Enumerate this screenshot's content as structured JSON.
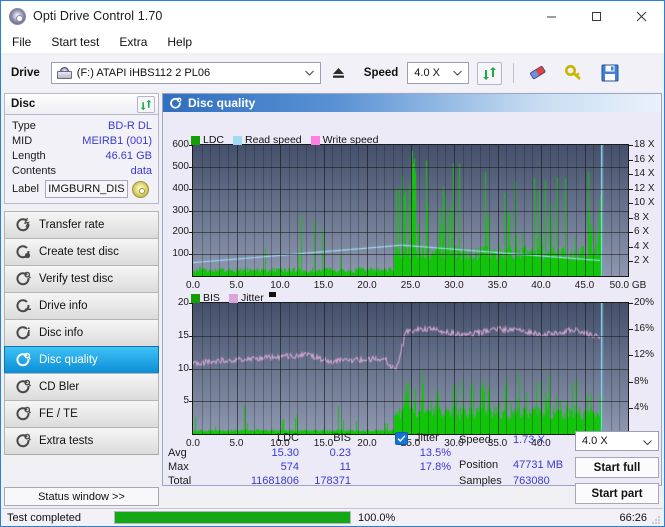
{
  "window": {
    "title": "Opti Drive Control 1.70",
    "icon": "disc-icon",
    "minimize": "minimize",
    "maximize": "maximize",
    "close": "close"
  },
  "menu": {
    "items": [
      {
        "label": "File"
      },
      {
        "label": "Start test"
      },
      {
        "label": "Extra"
      },
      {
        "label": "Help"
      }
    ]
  },
  "toolbar": {
    "drive_label": "Drive",
    "drive_value": "(F:)  ATAPI iHBS112  2 PL06",
    "eject_icon": "eject-icon",
    "speed_label": "Speed",
    "speed_value": "4.0 X",
    "refresh_icon": "refresh-icon",
    "eraser_icon": "eraser-icon",
    "key_icon": "key-icon",
    "save_icon": "save-icon"
  },
  "disc_panel": {
    "header": "Disc",
    "refresh_icon": "refresh-icon",
    "rows": [
      {
        "key": "Type",
        "value": "BD-R DL"
      },
      {
        "key": "MID",
        "value": "MEIRB1 (001)"
      },
      {
        "key": "Length",
        "value": "46.61 GB"
      },
      {
        "key": "Contents",
        "value": "data"
      }
    ],
    "label_key": "Label",
    "label_value": "IMGBURN_DIS",
    "label_icon": "disc-icon"
  },
  "nav": {
    "items": [
      {
        "label": "Transfer rate",
        "icon": "transfer-rate-icon",
        "active": false
      },
      {
        "label": "Create test disc",
        "icon": "create-test-disc-icon",
        "active": false
      },
      {
        "label": "Verify test disc",
        "icon": "verify-test-disc-icon",
        "active": false
      },
      {
        "label": "Drive info",
        "icon": "drive-info-icon",
        "active": false
      },
      {
        "label": "Disc info",
        "icon": "disc-info-icon",
        "active": false
      },
      {
        "label": "Disc quality",
        "icon": "disc-quality-icon",
        "active": true
      },
      {
        "label": "CD Bler",
        "icon": "cd-bler-icon",
        "active": false
      },
      {
        "label": "FE / TE",
        "icon": "fe-te-icon",
        "active": false
      },
      {
        "label": "Extra tests",
        "icon": "extra-tests-icon",
        "active": false
      }
    ],
    "status_window": "Status window >>"
  },
  "content": {
    "header_title": "Disc quality",
    "header_icon": "disc-quality-icon"
  },
  "stats": {
    "col_ldc": "LDC",
    "col_bis": "BIS",
    "col_jitter": "Jitter",
    "row_avg": "Avg",
    "row_max": "Max",
    "row_total": "Total",
    "avg_ldc": "15.30",
    "avg_bis": "0.23",
    "avg_jitter": "13.5%",
    "max_ldc": "574",
    "max_bis": "11",
    "max_jitter": "17.8%",
    "total_ldc": "11681806",
    "total_bis": "178371",
    "speed_key": "Speed",
    "speed_val": "1.73 X",
    "position_key": "Position",
    "position_val": "47731 MB",
    "samples_key": "Samples",
    "samples_val": "763080",
    "speed_select": "4.0 X",
    "start_full": "Start full",
    "start_part": "Start part",
    "jitter_checked": true
  },
  "statusbar": {
    "message": "Test completed",
    "percent": "100.0%",
    "percent_value": 100,
    "elapsed": "66:26"
  },
  "colors": {
    "ldc_green": "#12c40a",
    "read_speed_blue": "#9fdcf4",
    "write_speed_pink": "#ff7fe0",
    "jitter_pink": "#d7a8d7",
    "accent_blue": "#2f6fbf",
    "value_blue": "#3a3ad0",
    "progress_green": "#14a814"
  },
  "chart_data": [
    {
      "type": "line",
      "name": "disc-quality-ldc-chart",
      "title": "",
      "xlabel": "GB",
      "ylabel": "",
      "x": [
        0,
        50
      ],
      "xlim": [
        0,
        50
      ],
      "xticks": [
        "0.0",
        "5.0",
        "10.0",
        "15.0",
        "20.0",
        "25.0",
        "30.0",
        "35.0",
        "40.0",
        "45.0",
        "50.0 GB"
      ],
      "ylim": [
        0,
        600
      ],
      "yticks": [
        100,
        200,
        300,
        400,
        500,
        600
      ],
      "y2lim": [
        0,
        18
      ],
      "y2ticks": [
        "2 X",
        "4 X",
        "6 X",
        "8 X",
        "10 X",
        "12 X",
        "14 X",
        "16 X",
        "18 X"
      ],
      "grid": true,
      "legend": [
        {
          "label": "LDC",
          "color": "#12a000"
        },
        {
          "label": "Read speed",
          "color": "#9fdcf4"
        },
        {
          "label": "Write speed",
          "color": "#ff7fe0"
        }
      ],
      "series": [
        {
          "name": "LDC",
          "kind": "bars",
          "color": "#12c40a",
          "note": "dense error-rate spikes; baseline near 20-40 rising to ~120 after 23 GB; isolated peaks 250-300 before 23 GB; max spike 574 at ~25.2 GB; data ends at 46.8 GB"
        },
        {
          "name": "Read speed",
          "kind": "line",
          "color": "#9fdcf4",
          "note": "rises from 1.9X at 0 GB to ~4.3X at 24 GB, then declines to ~2.2X at 46.8 GB; vertical cyan marker at 46.9 GB"
        },
        {
          "name": "Write speed",
          "kind": "line",
          "color": "#ff7fe0",
          "note": "not plotted (no data)"
        }
      ]
    },
    {
      "type": "line",
      "name": "disc-quality-bis-jitter-chart",
      "title": "",
      "xlabel": "GB",
      "ylabel": "",
      "xlim": [
        0,
        50
      ],
      "xticks": [
        "0.0",
        "5.0",
        "10.0",
        "15.0",
        "20.0",
        "25.0",
        "30.0",
        "35.0",
        "40.0",
        "45.0",
        "50.0 GB"
      ],
      "ylim": [
        0,
        20
      ],
      "yticks": [
        5,
        10,
        15,
        20
      ],
      "y2lim": [
        0,
        20
      ],
      "y2ticks": [
        "4%",
        "8%",
        "12%",
        "16%",
        "20%"
      ],
      "grid": true,
      "legend": [
        {
          "label": "BIS",
          "color": "#12a000"
        },
        {
          "label": "Jitter",
          "color": "#d7a8d7"
        }
      ],
      "series": [
        {
          "name": "BIS",
          "kind": "bars",
          "color": "#12c40a",
          "note": "baseline ~0.4 below 23 GB with occasional spikes to 3-6; after 23 GB baseline ~3.5 with spikes to 11; data ends at 46.8 GB"
        },
        {
          "name": "Jitter",
          "kind": "line",
          "color": "#d7a8d7",
          "note": "approximately 10.8% at 0 GB rising to ~12% around 10-20 GB, dip to ~9.8% at 23 GB, then jumps to ~15.5-16.5% from 24 GB to 46 GB"
        }
      ]
    }
  ]
}
